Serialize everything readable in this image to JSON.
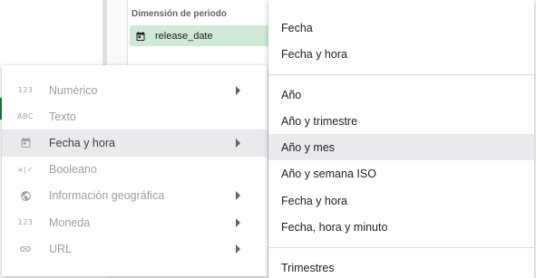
{
  "background": {
    "dimension_label": "Dimensión de periodo",
    "chip_label": "release_date"
  },
  "left_menu": {
    "items": [
      {
        "icon_text": "123",
        "icon": "numeric-icon",
        "label": "Numérico",
        "submenu": true
      },
      {
        "icon_text": "ABC",
        "icon": "text-icon",
        "label": "Texto",
        "submenu": false
      },
      {
        "icon_text": "",
        "icon": "calendar-icon",
        "label": "Fecha y hora",
        "submenu": true,
        "selected": true
      },
      {
        "icon_text": "×|✓",
        "icon": "boolean-icon",
        "label": "Booleano",
        "submenu": false
      },
      {
        "icon_text": "",
        "icon": "globe-icon",
        "label": "Información geográfica",
        "submenu": true
      },
      {
        "icon_text": "123",
        "icon": "currency-icon",
        "label": "Moneda",
        "submenu": true
      },
      {
        "icon_text": "",
        "icon": "link-icon",
        "label": "URL",
        "submenu": true
      }
    ]
  },
  "right_menu": {
    "group1": [
      "Fecha",
      "Fecha y hora"
    ],
    "group2": [
      "Año",
      "Año y trimestre",
      "Año y mes",
      "Año y semana ISO",
      "Fecha y hora",
      "Fecha, hora y minuto"
    ],
    "group3": [
      "Trimestres"
    ],
    "selected": "Año y mes"
  }
}
